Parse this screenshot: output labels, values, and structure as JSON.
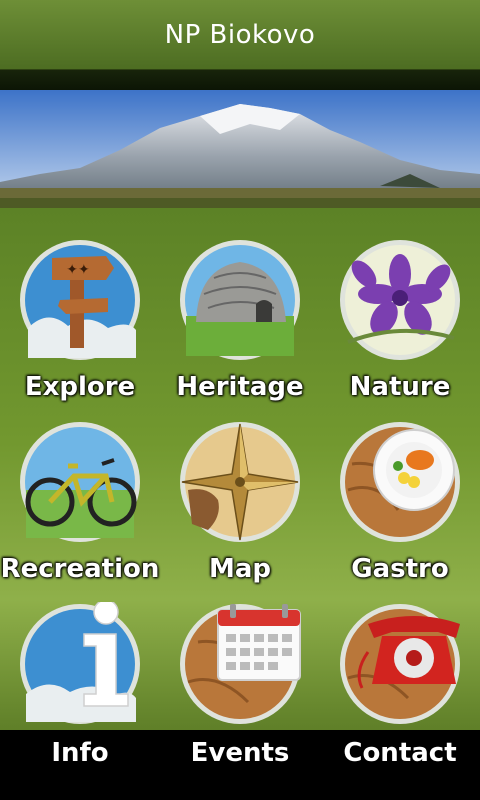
{
  "header": {
    "title": "NP Biokovo"
  },
  "banner": {
    "description_icon": "mountain-banner"
  },
  "menu": [
    {
      "label": "Explore",
      "icon": "signpost-icon"
    },
    {
      "label": "Heritage",
      "icon": "stone-hut-icon"
    },
    {
      "label": "Nature",
      "icon": "flower-icon"
    },
    {
      "label": "Recreation",
      "icon": "bicycle-icon"
    },
    {
      "label": "Map",
      "icon": "compass-icon"
    },
    {
      "label": "Gastro",
      "icon": "plate-icon"
    },
    {
      "label": "Info",
      "icon": "info-icon"
    },
    {
      "label": "Events",
      "icon": "calendar-icon"
    },
    {
      "label": "Contact",
      "icon": "telephone-icon"
    }
  ],
  "colors": {
    "header_green": "#5a7d2a",
    "background_green": "#72982f",
    "label_text": "#ffffff"
  }
}
